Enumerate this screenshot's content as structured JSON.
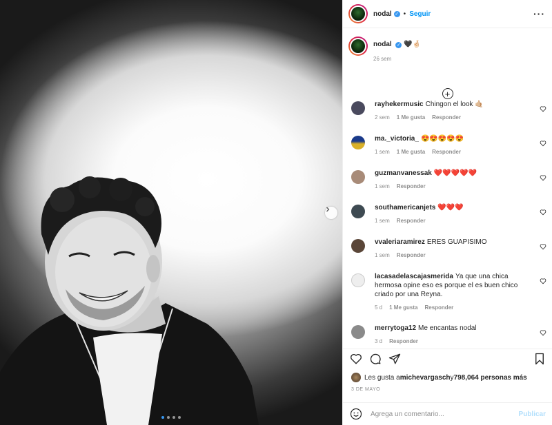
{
  "header": {
    "username": "nodal",
    "verified_icon": "verified-badge-icon",
    "separator": "•",
    "follow_label": "Seguir",
    "more_icon": "more-options-icon",
    "more_glyph": "···"
  },
  "caption": {
    "username": "nodal",
    "text": "🖤🤞🏻",
    "time": "26 sem"
  },
  "load_more_icon": "plus-circle-icon",
  "comments": [
    {
      "username": "rayhekermusic",
      "text": "Chingon el look 🤙🏼",
      "time": "2 sem",
      "likes": "1 Me gusta",
      "reply": "Responder",
      "avatar_color": "#4a4a5e"
    },
    {
      "username": "ma._victoria_",
      "text": "😍😍😍😍😍",
      "time": "1 sem",
      "likes": "1 Me gusta",
      "reply": "Responder",
      "avatar_color": "#c9a227"
    },
    {
      "username": "guzmanvanessak",
      "text": "❤️❤️❤️❤️❤️",
      "time": "1 sem",
      "likes": "",
      "reply": "Responder",
      "avatar_color": "#a88b78"
    },
    {
      "username": "southamericanjets",
      "text": "❤️❤️❤️",
      "time": "1 sem",
      "likes": "",
      "reply": "Responder",
      "avatar_color": "#3e4a52"
    },
    {
      "username": "vvaleriaramirez",
      "text": "ERES GUAPISIMO",
      "time": "1 sem",
      "likes": "",
      "reply": "Responder",
      "avatar_color": "#5a4638"
    },
    {
      "username": "lacasadelascajasmerida",
      "text": "Ya que una chica hermosa opine eso es porque el es buen chico criado por una Reyna.",
      "time": "5 d",
      "likes": "1 Me gusta",
      "reply": "Responder",
      "avatar_color": "#e8e8e8"
    },
    {
      "username": "merrytoga12",
      "text": "Me encantas nodal",
      "time": "3 d",
      "likes": "",
      "reply": "Responder",
      "avatar_color": "#8a8a8a"
    }
  ],
  "actions": {
    "like_icon": "heart-icon",
    "comment_icon": "comment-icon",
    "share_icon": "share-icon",
    "save_icon": "bookmark-icon"
  },
  "likes": {
    "prefix": "Les gusta a ",
    "user": "michevargasch",
    "middle": " y ",
    "count": "798,064 personas más"
  },
  "date": "3 DE MAYO",
  "add_comment": {
    "placeholder": "Agrega un comentario...",
    "publish_label": "Publicar",
    "emoji_icon": "emoji-smiley-icon"
  },
  "carousel": {
    "next_icon": "chevron-right-icon",
    "dots": 4,
    "active": 0
  }
}
